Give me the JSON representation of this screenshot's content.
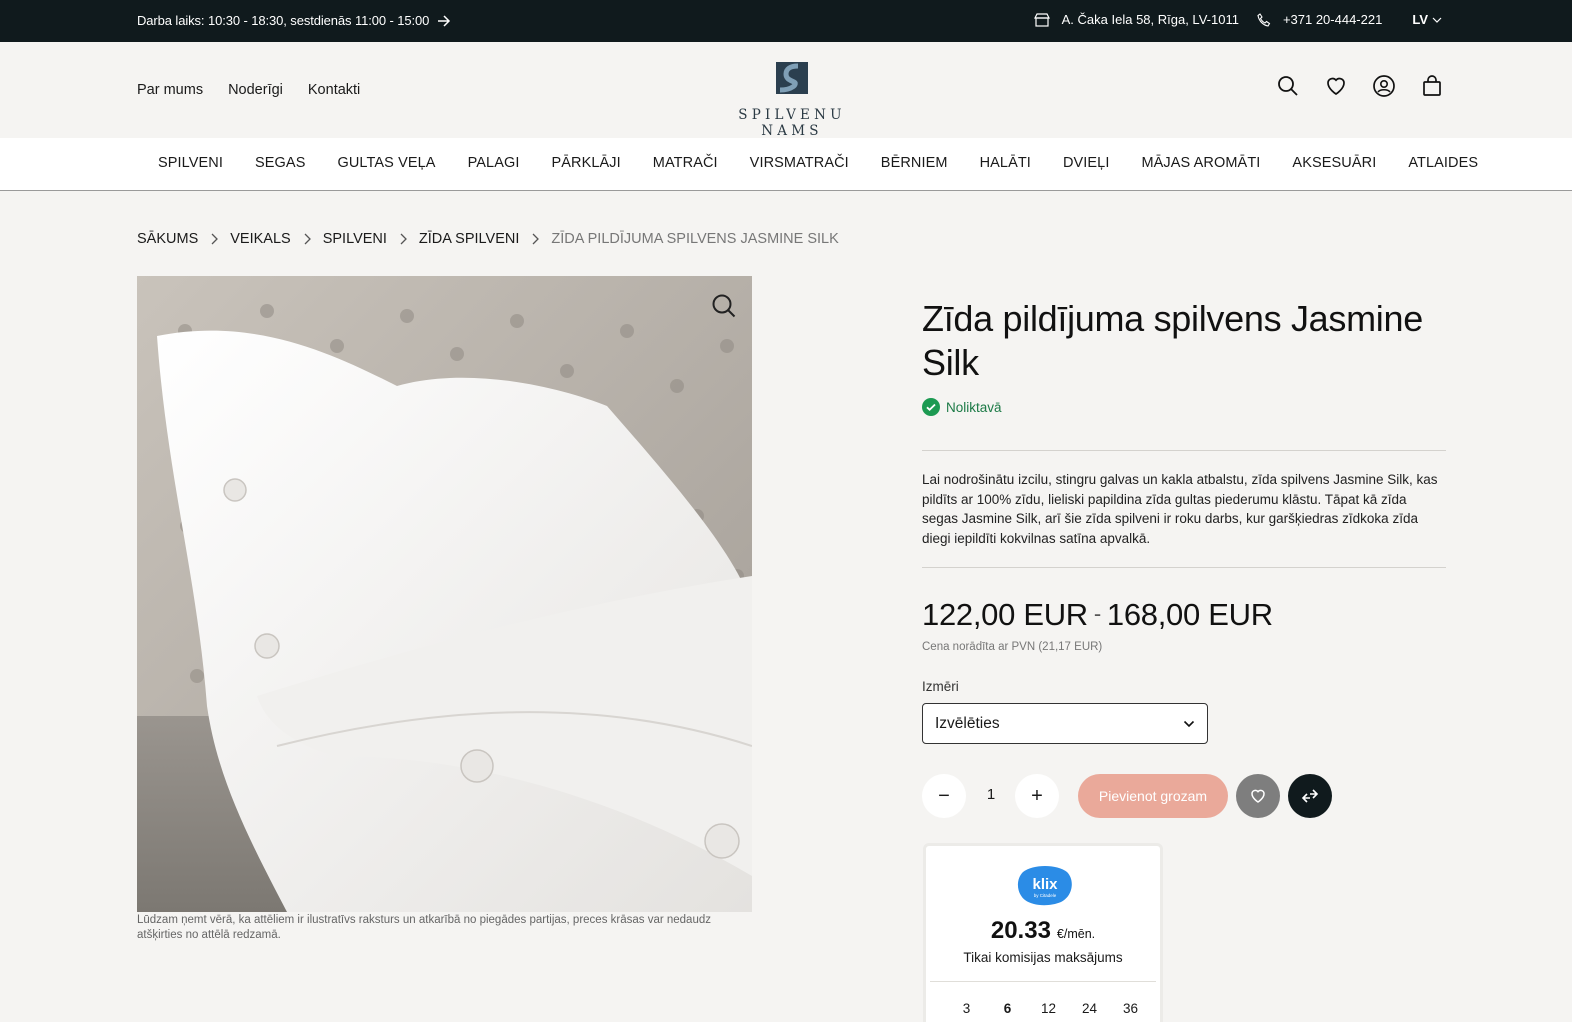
{
  "topbar": {
    "hours": "Darba laiks: 10:30 - 18:30, sestdienās 11:00 - 15:00",
    "address": "A. Čaka Iela 58, Rīga, LV-1011",
    "phone": "+371 20-444-221",
    "language": "LV"
  },
  "header": {
    "links": [
      "Par mums",
      "Noderīgi",
      "Kontakti"
    ],
    "logo_text": "SPILVENU NAMS"
  },
  "nav": {
    "items": [
      "SPILVENI",
      "SEGAS",
      "GULTAS VEĻA",
      "PALAGI",
      "PĀRKLĀJI",
      "MATRAČI",
      "VIRSMATRAČI",
      "BĒRNIEM",
      "HALĀTI",
      "DVIEĻI",
      "MĀJAS AROMĀTI",
      "AKSESUĀRI",
      "ATLAIDES"
    ]
  },
  "breadcrumb": [
    "SĀKUMS",
    "VEIKALS",
    "SPILVENI",
    "ZĪDA SPILVENI",
    "ZĪDA PILDĪJUMA SPILVENS JASMINE SILK"
  ],
  "gallery": {
    "disclaimer": "Lūdzam ņemt vērā, ka attēliem ir ilustratīvs raksturs un atkarībā no piegādes partijas, preces krāsas var nedaudz atšķirties no attēlā redzamā."
  },
  "product": {
    "title": "Zīda pildījuma spilvens Jasmine Silk",
    "stock": "Noliktavā",
    "description": "Lai nodrošinātu izcilu, stingru galvas un kakla atbalstu, zīda spilvens Jasmine Silk, kas pildīts ar 100% zīdu, lieliski papildina zīda gultas piederumu klāstu. Tāpat kā  zīda segas Jasmine Silk, arī šie zīda spilveni ir roku darbs, kur garšķiedras zīdkoka zīda diegi iepildīti kokvilnas satīna apvalkā.",
    "price_min": "122,00 EUR",
    "price_sep": "-",
    "price_max": "168,00 EUR",
    "vat_note": "Cena norādīta ar PVN (21,17 EUR)",
    "size_label": "Izmēri",
    "size_selected": "Izvēlēties",
    "quantity": "1",
    "minus": "−",
    "plus": "+",
    "add_to_cart": "Pievienot grozam"
  },
  "klix": {
    "logo_text": "klix",
    "logo_sub": "by Citadele",
    "amount": "20.33",
    "unit": "€/mēn.",
    "note": "Tikai komisijas maksājums",
    "months": [
      "3",
      "6",
      "12",
      "24",
      "36"
    ],
    "active_month": "6"
  },
  "colors": {
    "topbar": "#101a1d",
    "stock_green": "#1c7a46",
    "add_to_cart": "#eaa99a",
    "klix_blue": "#2b8ce6"
  }
}
